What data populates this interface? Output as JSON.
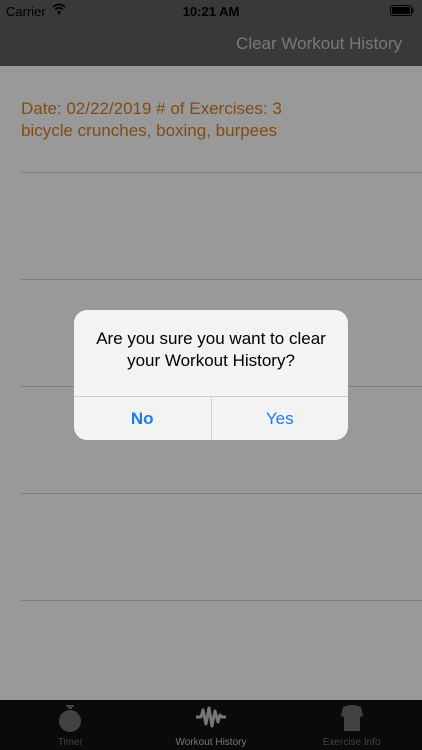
{
  "status_bar": {
    "carrier": "Carrier",
    "time": "10:21 AM"
  },
  "nav_bar": {
    "action": "Clear Workout History"
  },
  "history": [
    {
      "line1": "Date:  02/22/2019  # of Exercises: 3",
      "line2": "bicycle crunches,  boxing,  burpees"
    }
  ],
  "alert": {
    "message": "Are you sure you want to clear your Workout History?",
    "no_label": "No",
    "yes_label": "Yes"
  },
  "tab_bar": {
    "tabs": [
      {
        "label": "Timer",
        "icon": "stopwatch-icon"
      },
      {
        "label": "Workout History",
        "icon": "waveform-icon",
        "selected": true
      },
      {
        "label": "Exercise Info",
        "icon": "torso-icon"
      }
    ]
  },
  "colors": {
    "accent": "#1d7cf2",
    "history_text": "#d97e23",
    "nav_bg": "#5f5f5f"
  }
}
